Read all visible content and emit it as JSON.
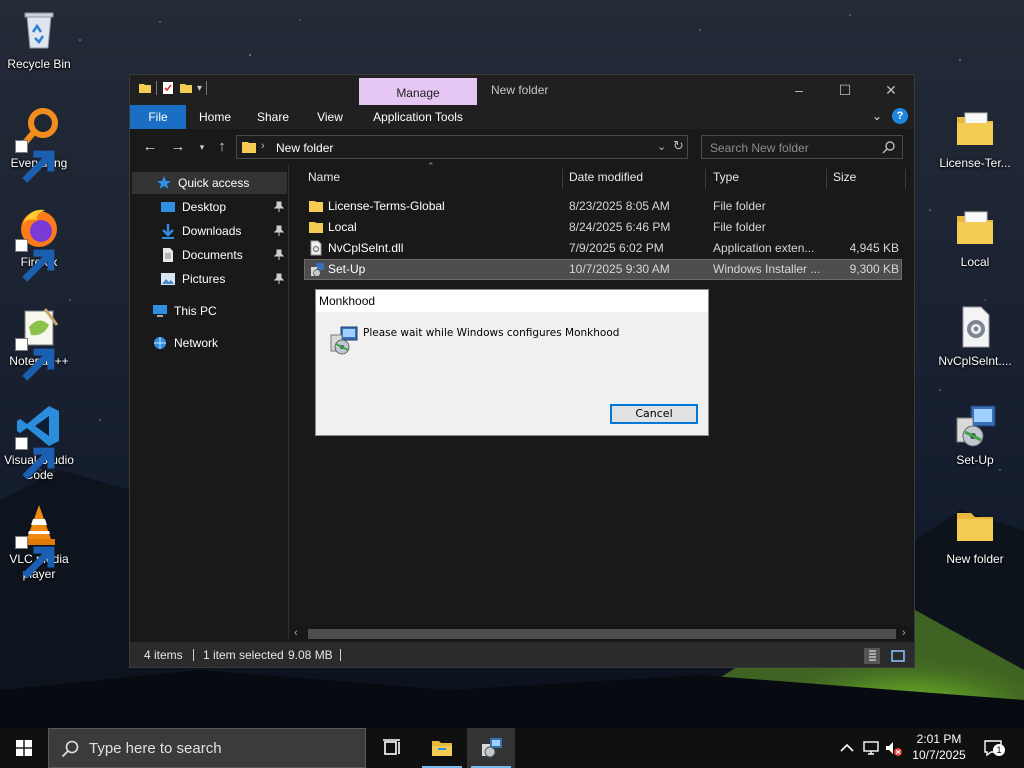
{
  "desktop": {
    "icons_left": [
      {
        "label": "Recycle Bin"
      },
      {
        "label": "Everything"
      },
      {
        "label": "Firefox"
      },
      {
        "label": "Notepad++"
      },
      {
        "label": "Visual Studio Code"
      },
      {
        "label": "VLC media player"
      }
    ],
    "icons_right": [
      {
        "label": "License-Ter..."
      },
      {
        "label": "Local"
      },
      {
        "label": "NvCplSelnt...."
      },
      {
        "label": "Set-Up"
      },
      {
        "label": "New folder"
      }
    ]
  },
  "explorer": {
    "title": "New folder",
    "manage_tab": "Manage",
    "ribbon_tabs": [
      "File",
      "Home",
      "Share",
      "View",
      "Application Tools"
    ],
    "help_label": "?",
    "address": {
      "crumb": "New folder"
    },
    "search": {
      "placeholder": "Search New folder"
    },
    "nav": {
      "quick_access": "Quick access",
      "pinned": [
        "Desktop",
        "Downloads",
        "Documents",
        "Pictures"
      ],
      "this_pc": "This PC",
      "network": "Network"
    },
    "columns": {
      "name": "Name",
      "date": "Date modified",
      "type": "Type",
      "size": "Size"
    },
    "files": [
      {
        "name": "License-Terms-Global",
        "date": "8/23/2025 8:05 AM",
        "type": "File folder",
        "size": "",
        "kind": "folder",
        "selected": false
      },
      {
        "name": "Local",
        "date": "8/24/2025 6:46 PM",
        "type": "File folder",
        "size": "",
        "kind": "folder",
        "selected": false
      },
      {
        "name": "NvCplSelnt.dll",
        "date": "7/9/2025 6:02 PM",
        "type": "Application exten...",
        "size": "4,945 KB",
        "kind": "dll",
        "selected": false
      },
      {
        "name": "Set-Up",
        "date": "10/7/2025 9:30 AM",
        "type": "Windows Installer ...",
        "size": "9,300 KB",
        "kind": "msi",
        "selected": true
      }
    ],
    "status": {
      "items": "4 items",
      "selection": "1 item selected",
      "size": "9.08 MB"
    }
  },
  "dialog": {
    "title": "Monkhood",
    "message": "Please wait while Windows configures Monkhood",
    "cancel_label": "Cancel"
  },
  "taskbar": {
    "search_placeholder": "Type here to search",
    "time": "2:01 PM",
    "date": "10/7/2025",
    "notification_count": "1"
  },
  "colors": {
    "accent": "#1a6fc4",
    "manage_tab": "#e6c6f2",
    "focus_border": "#0078d7",
    "folder": "#f4cc54"
  }
}
